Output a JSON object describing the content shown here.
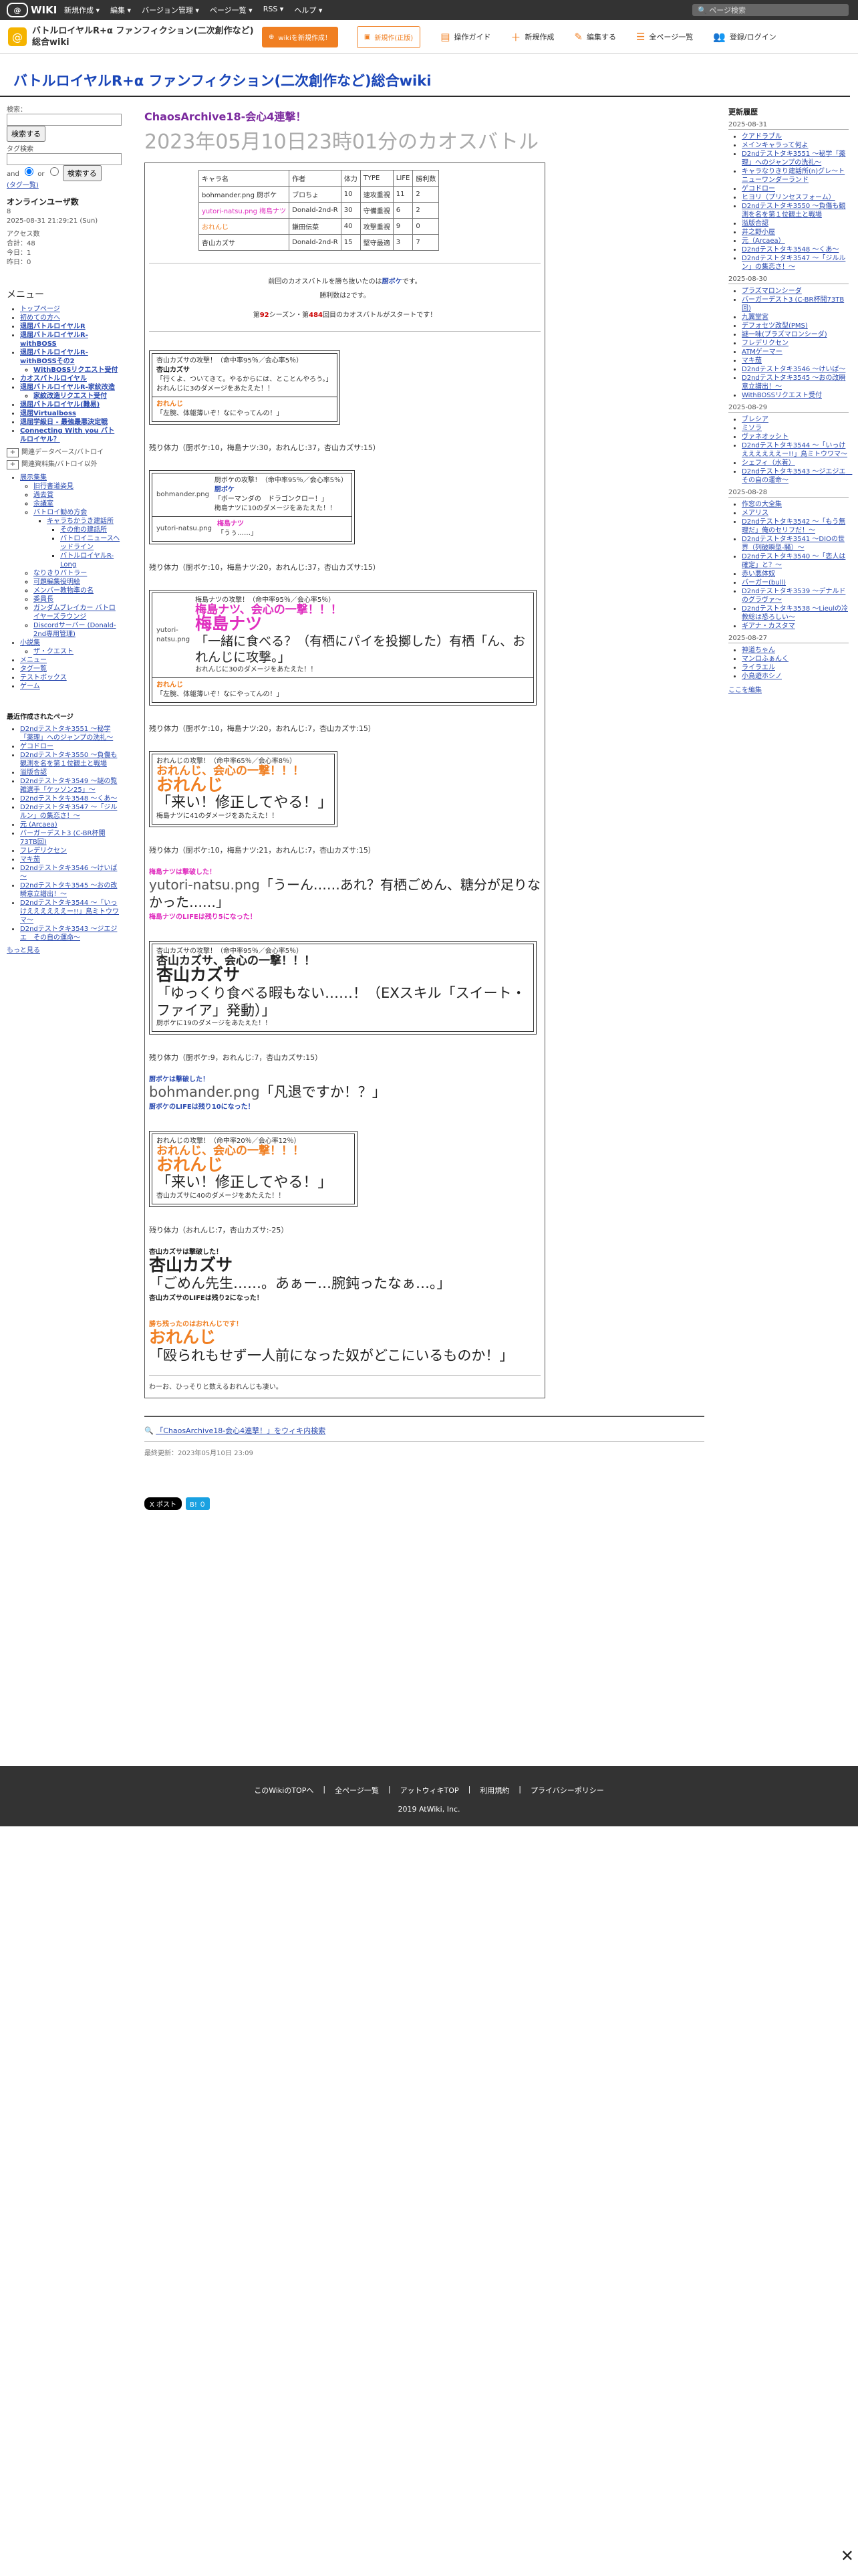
{
  "topbar": {
    "logo": "WIKI",
    "menu": [
      "新規作成 ▾",
      "編集 ▾",
      "バージョン管理 ▾",
      "ページ一覧 ▾",
      "RSS ▾",
      "ヘルプ ▾"
    ],
    "search_placeholder": "ページ検索"
  },
  "header": {
    "site_title": "バトルロイヤルR+α ファンフィクション(二次創作など)総合wiki",
    "btn_wiki_new": "wikiを新規作成！",
    "btn_wiki_update": "新規作(正版)",
    "links": [
      "操作ガイド",
      "新規作成",
      "編集する",
      "全ページ一覧",
      "登録/ログイン"
    ]
  },
  "wiki_title": "バトルロイヤルR+α ファンフィクション(二次創作など)総合wiki",
  "left": {
    "search_label": "検索：",
    "search_button": "検索する",
    "tag_label": "タグ検索",
    "and_label": "and",
    "or_label": "or",
    "tag_button": "検索する",
    "tag_link": "(タグ一覧)",
    "online_title": "オンラインユーザ数",
    "online_count": "8",
    "online_date": "2025-08-31 21:29:21 (Sun)",
    "access_title": "アクセス数",
    "access_total": "合計：48",
    "access_today": "今日：1",
    "access_yesterday": "昨日：0",
    "menu_title": "メニュー",
    "menu_items": [
      "トップページ",
      "初めての方へ",
      "退屈バトルロイヤルR",
      "退屈バトルロイヤルR-withBOSS",
      "退屈バトルロイヤルR-withBOSSその2",
      "WithBOSSリクエスト受付",
      "カオスバトルロイヤル",
      "退屈バトルロイヤルR-家紋改造",
      "家紋改造リクエスト受付",
      "退屈バトルロイヤル(難易)",
      "退屈Virtualboss",
      "退屈学級日 - 最強最悪決定戦",
      "Connecting With you バトルロイヤル？"
    ],
    "collapse_1": "関連データベース/バトロイ",
    "collapse_2": "関連資料集/バトロイ以外",
    "tree": [
      "展示集集",
      "旧行書道姿見",
      "過去賞",
      "余議室",
      "バトロイ勧め方会",
      "キャラちかうき建話所",
      "その他の建話所",
      "バトロイニュースヘッドライン",
      "バトルロイヤルR-Long",
      "なりきりバトラー",
      "可題編集役明絵",
      "メンバー教物準の名",
      "委員長",
      "ガンダムブレイカー バトロイヤーズラウンジ",
      "Discordサーバー (Donald-2nd専用管理)",
      "小説集",
      "ザ・クエスト",
      "メニュー",
      "タグ一覧",
      "テストボックス",
      "ゲーム"
    ],
    "recent_title": "最近作成されたページ",
    "recent": [
      "D2ndテストタキ3551 ～秘学「薬理」へのジャンプの洗礼～",
      "ゲコドロー",
      "D2ndテストタキ3550 ～負傷も観測を名を第１位観土と戦場",
      "溢版合認",
      "D2ndテストタキ3549 ～謎の覧雑選手「ケッソン25」～",
      "D2ndテストタキ3548 ～くあ～",
      "D2ndテストタキ3547 ～「ジルルン」の集恋さ！～",
      "元 (Arcaea)",
      "バーガーデスト3 (C-BR杯開73TB回)",
      "フレデリクセン",
      "マキ茄",
      "D2ndテストタキ3546 ～けいば～",
      "D2ndテストタキ3545 ～おの改瞬意立譜出！～",
      "D2ndテストタキ3544 ～「いっけええええええー!!」鳥ミトウワマ～",
      "D2ndテストタキ3543 ～ジエジエ　その自の運命～"
    ],
    "more": "もっと見る"
  },
  "main": {
    "subtitle": "ChaosArchive18-会心4連撃！",
    "title": "2023年05月10日23時01分のカオスバトル",
    "table_headers": [
      "キャラ名",
      "作者",
      "体力",
      "TYPE",
      "LIFE",
      "勝利数"
    ],
    "table_rows": [
      {
        "name": "bohmander.png 厨ボケ",
        "author": "ブロちょ",
        "hp": "10",
        "type": "速攻重視",
        "life": "11",
        "wins": "2"
      },
      {
        "name": "yutori-natsu.png 梅島ナツ",
        "author": "Donald-2nd-R",
        "hp": "30",
        "type": "守備重視",
        "life": "6",
        "wins": "2"
      },
      {
        "name": "おれんじ",
        "author": "鎌田伝菜",
        "hp": "40",
        "type": "攻撃重視",
        "life": "9",
        "wins": "0"
      },
      {
        "name": "杏山カズサ",
        "author": "Donald-2nd-R",
        "hp": "15",
        "type": "堅守最適",
        "life": "3",
        "wins": "7"
      }
    ],
    "intro_1": "前回のカオスバトルを勝ち抜いたのは",
    "intro_winner": "厨ボケ",
    "intro_1b": "です。",
    "intro_2": "勝利数は2です。",
    "intro_3a": "第",
    "season": "92",
    "intro_3b": "シーズン・第",
    "battle_no": "484",
    "intro_3c": "回目のカオスバトルがスタートです！",
    "hp_lines": [
      "残り体力（厨ボケ:10，梅島ナツ:30，おれんじ:37，杏山カズサ:15）",
      "残り体力（厨ボケ:10，梅島ナツ:20，おれんじ:37，杏山カズサ:15）",
      "残り体力（厨ボケ:10，梅島ナツ:20，おれんじ:7，杏山カズサ:15）",
      "残り体力（厨ボケ:10，梅島ナツ:21，おれんじ:7，杏山カズサ:15）",
      "残り体力（厨ボケ:9，おれんじ:7，杏山カズサ:15）",
      "残り体力（おれんじ:7，杏山カズサ:-25）"
    ],
    "turn1": {
      "line1": "杏山カズサの攻撃！（命中率95％／会心率5％）",
      "name": "杏山カズサ",
      "quote": "「行くよ、ついてきて。やるからには、とことんやろう。」",
      "dmg": "おれんじに3のダメージをあたえた！！",
      "reply_name": "おれんじ",
      "reply": "「左腕、体躯薄いぞ！なにやってんの！」"
    },
    "turn2": {
      "line1": "厨ボケの攻撃！（命中率95％／会心率5％）",
      "name": "厨ボケ",
      "quote": "「ボーマンダの　ドラゴンクロー！」",
      "dmg": "梅島ナツに10のダメージをあたえた！！",
      "reply_name": "梅島ナツ",
      "reply": "「うぅ……」",
      "img1": "bohmander.png",
      "img2": "yutori-natsu.png"
    },
    "turn3": {
      "line1": "梅島ナツの攻撃！（命中率95％／会心率5％）",
      "crit": "梅島ナツ、会心の一撃！！！",
      "bigname": "梅島ナツ",
      "quote": "「一緒に食べる？（有栖にパイを投擲した）有栖「ん、おれんじに攻撃。」",
      "dmg": "おれんじに30のダメージをあたえた！！",
      "reply_name": "おれんじ",
      "reply": "「左腕、体躯薄いぞ！なにやってんの！」",
      "img": "yutori-natsu.png"
    },
    "turn4": {
      "line1": "おれんじの攻撃！（命中率65％／会心率8％）",
      "crit": "おれんじ、会心の一撃！！！",
      "bigname": "おれんじ",
      "quote": "「来い！修正してやる！」",
      "dmg": "梅島ナツに41のダメージをあたえた！！"
    },
    "ko1": {
      "line": "梅島ナツは撃破した！",
      "img": "yutori-natsu.png",
      "quote": "「うーん……あれ？有栖ごめん、糖分が足りなかった……」",
      "life": "梅島ナツのLIFEは残り5になった！"
    },
    "turn5": {
      "line1": "杏山カズサの攻撃！（命中率95％／会心率5％）",
      "crit": "杏山カズサ、会心の一撃！！！",
      "bigname": "杏山カズサ",
      "quote": "「ゆっくり食べる暇もない……！（EXスキル「スイート・ファイア」発動）」",
      "dmg": "厨ボケに19のダメージをあたえた！！"
    },
    "ko2": {
      "line": "厨ボケは撃破した！",
      "img": "bohmander.png",
      "quote": "「凡退ですか！？」",
      "life": "厨ボケのLIFEは残り10になった！"
    },
    "turn6": {
      "line1": "おれんじの攻撃！（命中率20％／会心率12％）",
      "crit": "おれんじ、会心の一撃！！！",
      "bigname": "おれんじ",
      "quote": "「来い！修正してやる！」",
      "dmg": "杏山カズサに40のダメージをあたえた！！"
    },
    "ko3": {
      "line": "杏山カズサは撃破した！",
      "bigname": "杏山カズサ",
      "quote": "「ごめん先生……。あぁー…腕鈍ったなぁ…。」",
      "life": "杏山カズサのLIFEは残り2になった！"
    },
    "final": {
      "line": "勝ち残ったのはおれんじです！",
      "bigname": "おれんじ",
      "quote": "「殴られもせず一人前になった奴がどこにいるものか！」"
    },
    "closing": "わーお、ひっそりと数えるおれんじも凄い。",
    "wiki_search": "「ChaosArchive18-会心4連撃！」をウィキ内検索",
    "updated": "最終更新：2023年05月10日 23:09",
    "share_x": "X ポスト",
    "share_hatena": "B! ０"
  },
  "right": {
    "title": "更新履歴",
    "groups": [
      {
        "date": "2025-08-31",
        "items": [
          "クアドラブル",
          "メインキャラって何よ",
          "D2ndテストタキ3551 ～秘学「薬理」へのジャンプの洗礼～",
          "キャラなりきり建話所(n)グレ～トニューワンダーランド",
          "ゲコドロー",
          "ヒヨリ（プリンセスフォーム）",
          "D2ndテストタキ3550 ～負傷も観測を名を第１位観土と戦場",
          "溢版合認",
          "井之野小屋",
          "元（Arcaea）",
          "D2ndテストタキ3548 ～くあ～",
          "D2ndテストタキ3547 ～「ジルルン」の集恋さ！～"
        ]
      },
      {
        "date": "2025-08-30",
        "items": [
          "プラズマロンシーダ",
          "バーガーデスト3 (C-BR杯開73TB回)",
          "九翼堂宮",
          "デフォセツ改型(PMS)",
          "謎一味(プラズマロンシーダ)",
          "フレデリクセン",
          "ATMゲーマー",
          "マキ茄",
          "D2ndテストタキ3546 ～けいば～",
          "D2ndテストタキ3545 ～おの改瞬意立譜出！～",
          "WithBOSSリクエスト受付"
        ]
      },
      {
        "date": "2025-08-29",
        "items": [
          "ブレシア",
          "ミソラ",
          "ヴァネオッシト",
          "D2ndテストタキ3544 ～「いっけええええええー!!」鳥ミトウワマ～",
          "シェフィ（水着）",
          "D2ndテストタキ3543 ～ジエジエ　その自の運命～"
        ]
      },
      {
        "date": "2025-08-28",
        "items": [
          "作窓の大全集",
          "メアリス",
          "D2ndテストタキ3542 ～「もう無理だ」俺のセリフだ！～",
          "D2ndテストタキ3541 ～DIOの世界（列破瞬型-騒）～",
          "D2ndテストタキ3540 ～「恋人は確定」と？～",
          "赤い悪体奴",
          "バーガー(bull)",
          "D2ndテストタキ3539 ～デナルドのグラヴァ～",
          "D2ndテストタキ3538 ～Lieulの冷教総は恐ろしい～",
          "ギアナ・カスタマ"
        ]
      },
      {
        "date": "2025-08-27",
        "items": [
          "神道ちゃん",
          "マンロふぁんく",
          "ライラエル",
          "小鳥遊ホシノ"
        ]
      }
    ],
    "more": "ここを編集"
  },
  "footer": {
    "links": [
      "このWikiのTOPへ",
      "全ページ一覧",
      "アットウィキTOP",
      "利用規約",
      "プライバシーポリシー"
    ],
    "copyright": "2019 AtWiki, Inc."
  }
}
